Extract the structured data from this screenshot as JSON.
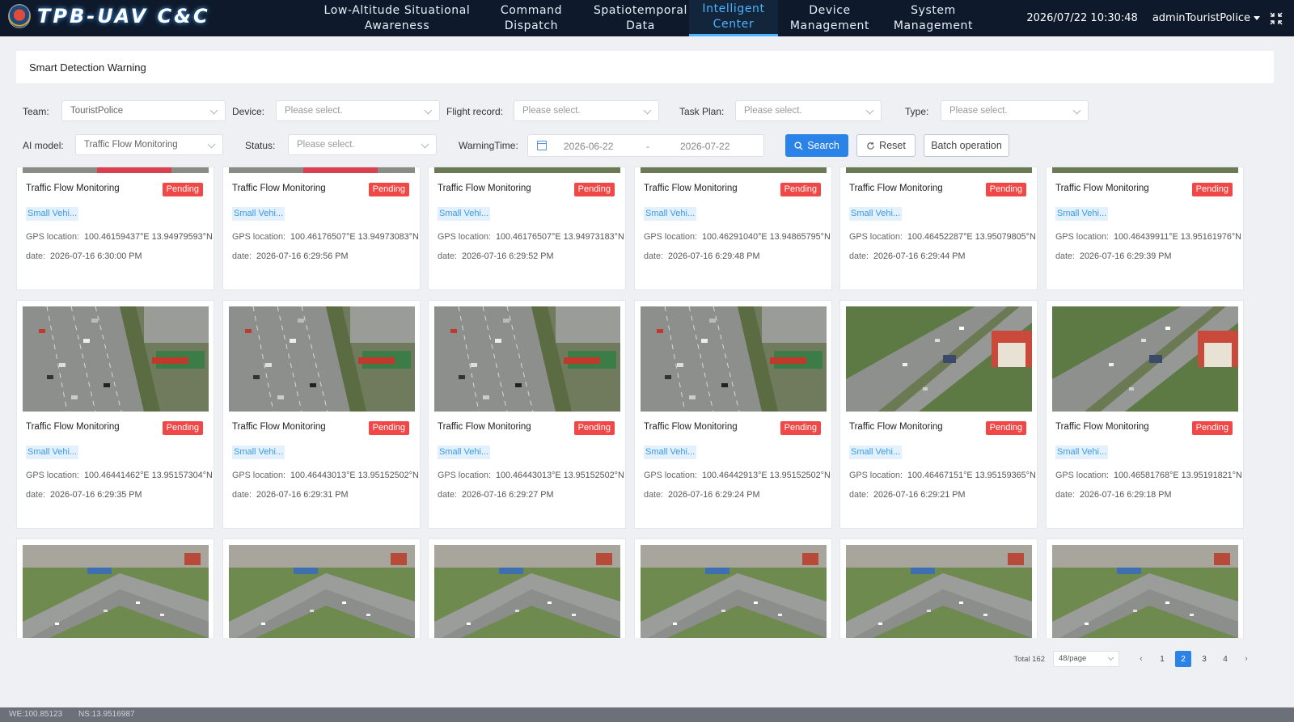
{
  "header": {
    "logo_text": "TPB-UAV C&C",
    "nav": [
      {
        "label": "Low-Altitude Situational\nAwareness",
        "active": false
      },
      {
        "label": "Command\nDispatch",
        "active": false
      },
      {
        "label": "Spatiotemporal\nData",
        "active": false
      },
      {
        "label": "Intelligent\nCenter",
        "active": true
      },
      {
        "label": "Device\nManagement",
        "active": false
      },
      {
        "label": "System\nManagement",
        "active": false
      }
    ],
    "datetime": "2026/07/22 10:30:48",
    "user": "adminTouristPolice"
  },
  "page_title": "Smart Detection Warning",
  "filters": {
    "team_label": "Team:",
    "team_value": "TouristPolice",
    "device_label": "Device:",
    "device_placeholder": "Please select.",
    "flight_label": "Flight record:",
    "flight_placeholder": "Please select.",
    "taskplan_label": "Task Plan:",
    "taskplan_placeholder": "Please select.",
    "type_label": "Type:",
    "type_placeholder": "Please select.",
    "aimodel_label": "AI model:",
    "aimodel_value": "Traffic Flow Monitoring",
    "status_label": "Status:",
    "status_placeholder": "Please select.",
    "warningtime_label": "WarningTime:",
    "date_start": "2026-06-22",
    "date_sep": "-",
    "date_end": "2026-07-22",
    "search_label": "Search",
    "reset_label": "Reset",
    "batch_label": "Batch operation"
  },
  "card_labels": {
    "gps": "GPS location:",
    "date": "date:"
  },
  "cards": [
    {
      "title": "Traffic Flow Monitoring",
      "status": "Pending",
      "tag": "Small Vehi...",
      "gps": "100.46159437°E 13.94979593°N",
      "date": "2026-07-16 6:30:00 PM"
    },
    {
      "title": "Traffic Flow Monitoring",
      "status": "Pending",
      "tag": "Small Vehi...",
      "gps": "100.46176507°E 13.94973083°N",
      "date": "2026-07-16 6:29:56 PM"
    },
    {
      "title": "Traffic Flow Monitoring",
      "status": "Pending",
      "tag": "Small Vehi...",
      "gps": "100.46176507°E 13.94973183°N",
      "date": "2026-07-16 6:29:52 PM"
    },
    {
      "title": "Traffic Flow Monitoring",
      "status": "Pending",
      "tag": "Small Vehi...",
      "gps": "100.46291040°E 13.94865795°N",
      "date": "2026-07-16 6:29:48 PM"
    },
    {
      "title": "Traffic Flow Monitoring",
      "status": "Pending",
      "tag": "Small Vehi...",
      "gps": "100.46452287°E 13.95079805°N",
      "date": "2026-07-16 6:29:44 PM"
    },
    {
      "title": "Traffic Flow Monitoring",
      "status": "Pending",
      "tag": "Small Vehi...",
      "gps": "100.46439911°E 13.95161976°N",
      "date": "2026-07-16 6:29:39 PM"
    },
    {
      "title": "Traffic Flow Monitoring",
      "status": "Pending",
      "tag": "Small Vehi...",
      "gps": "100.46441462°E 13.95157304°N",
      "date": "2026-07-16 6:29:35 PM"
    },
    {
      "title": "Traffic Flow Monitoring",
      "status": "Pending",
      "tag": "Small Vehi...",
      "gps": "100.46443013°E 13.95152502°N",
      "date": "2026-07-16 6:29:31 PM"
    },
    {
      "title": "Traffic Flow Monitoring",
      "status": "Pending",
      "tag": "Small Vehi...",
      "gps": "100.46443013°E 13.95152502°N",
      "date": "2026-07-16 6:29:27 PM"
    },
    {
      "title": "Traffic Flow Monitoring",
      "status": "Pending",
      "tag": "Small Vehi...",
      "gps": "100.46442913°E 13.95152502°N",
      "date": "2026-07-16 6:29:24 PM"
    },
    {
      "title": "Traffic Flow Monitoring",
      "status": "Pending",
      "tag": "Small Vehi...",
      "gps": "100.46467151°E 13.95159365°N",
      "date": "2026-07-16 6:29:21 PM"
    },
    {
      "title": "Traffic Flow Monitoring",
      "status": "Pending",
      "tag": "Small Vehi...",
      "gps": "100.46581768°E 13.95191821°N",
      "date": "2026-07-16 6:29:18 PM"
    }
  ],
  "pagination": {
    "total": "Total 162",
    "page_size": "48/page",
    "pages": [
      "1",
      "2",
      "3",
      "4"
    ],
    "current": "2"
  },
  "statusbar": {
    "we": "WE:100.85123",
    "ns": "NS:13.9516987"
  }
}
